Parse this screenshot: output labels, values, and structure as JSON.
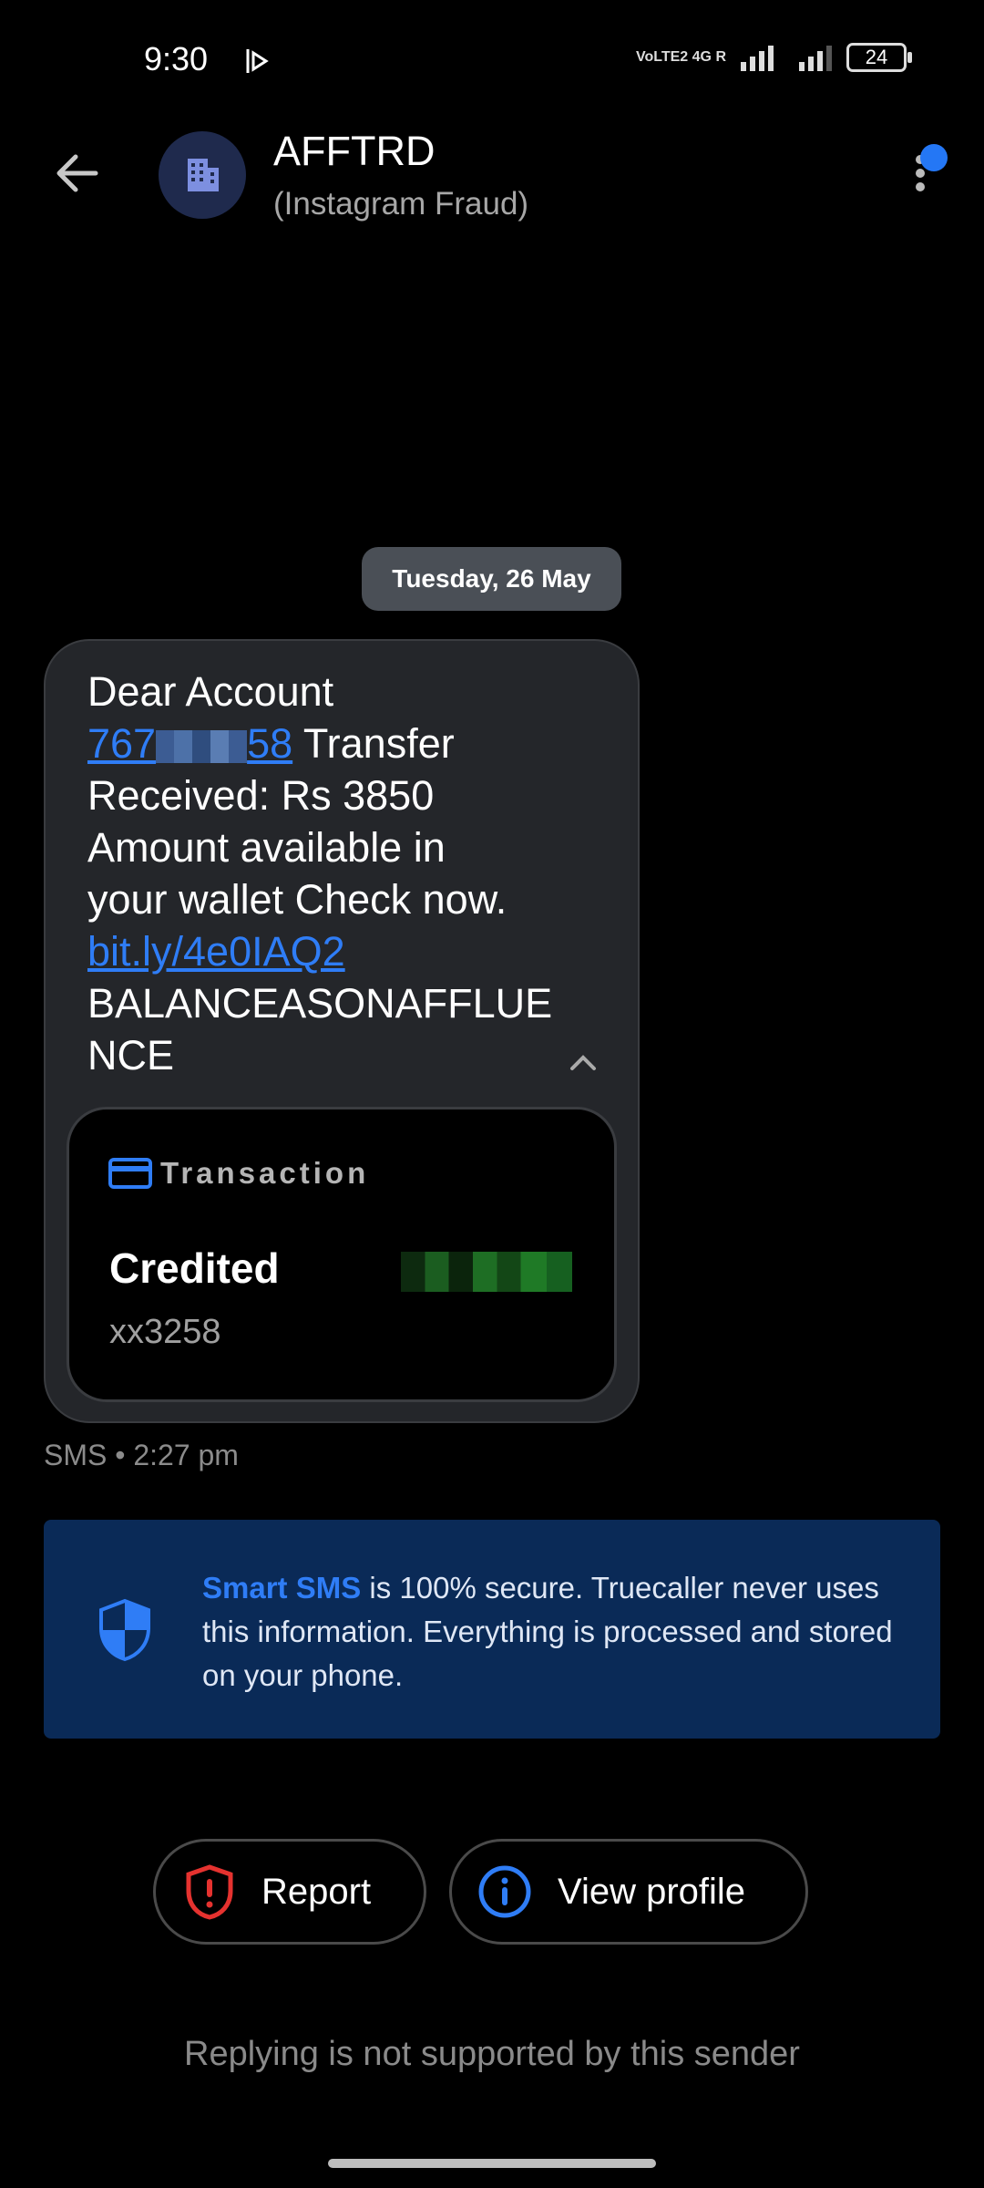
{
  "status_bar": {
    "time": "9:30",
    "network": "VoLTE2 4G R",
    "battery": "24"
  },
  "header": {
    "sender": "AFFTRD",
    "label": "(Instagram Fraud)",
    "avatar_icon": "building-icon",
    "accent_color": "#2477f5"
  },
  "date_separator": "Tuesday, 26 May",
  "message": {
    "line1": "Dear Account",
    "account_prefix": "767",
    "account_suffix": "58",
    "after_account": " Transfer",
    "line3": "Received: Rs 3850",
    "line4": "Amount available in",
    "line5": "your wallet Check now.",
    "link": "bit.ly/4e0IAQ2",
    "line7": "BALANCEASONAFFLUE",
    "line8": "NCE"
  },
  "transaction_card": {
    "title": "Transaction",
    "status": "Credited",
    "account": "xx3258"
  },
  "message_meta": "SMS • 2:27 pm",
  "smart_sms_banner": {
    "brand": "Smart SMS",
    "text": " is 100% secure. Truecaller never uses this information. Everything is processed and stored on your phone."
  },
  "actions": {
    "report": "Report",
    "view_profile": "View profile"
  },
  "reply_note": "Replying is not supported by this sender"
}
